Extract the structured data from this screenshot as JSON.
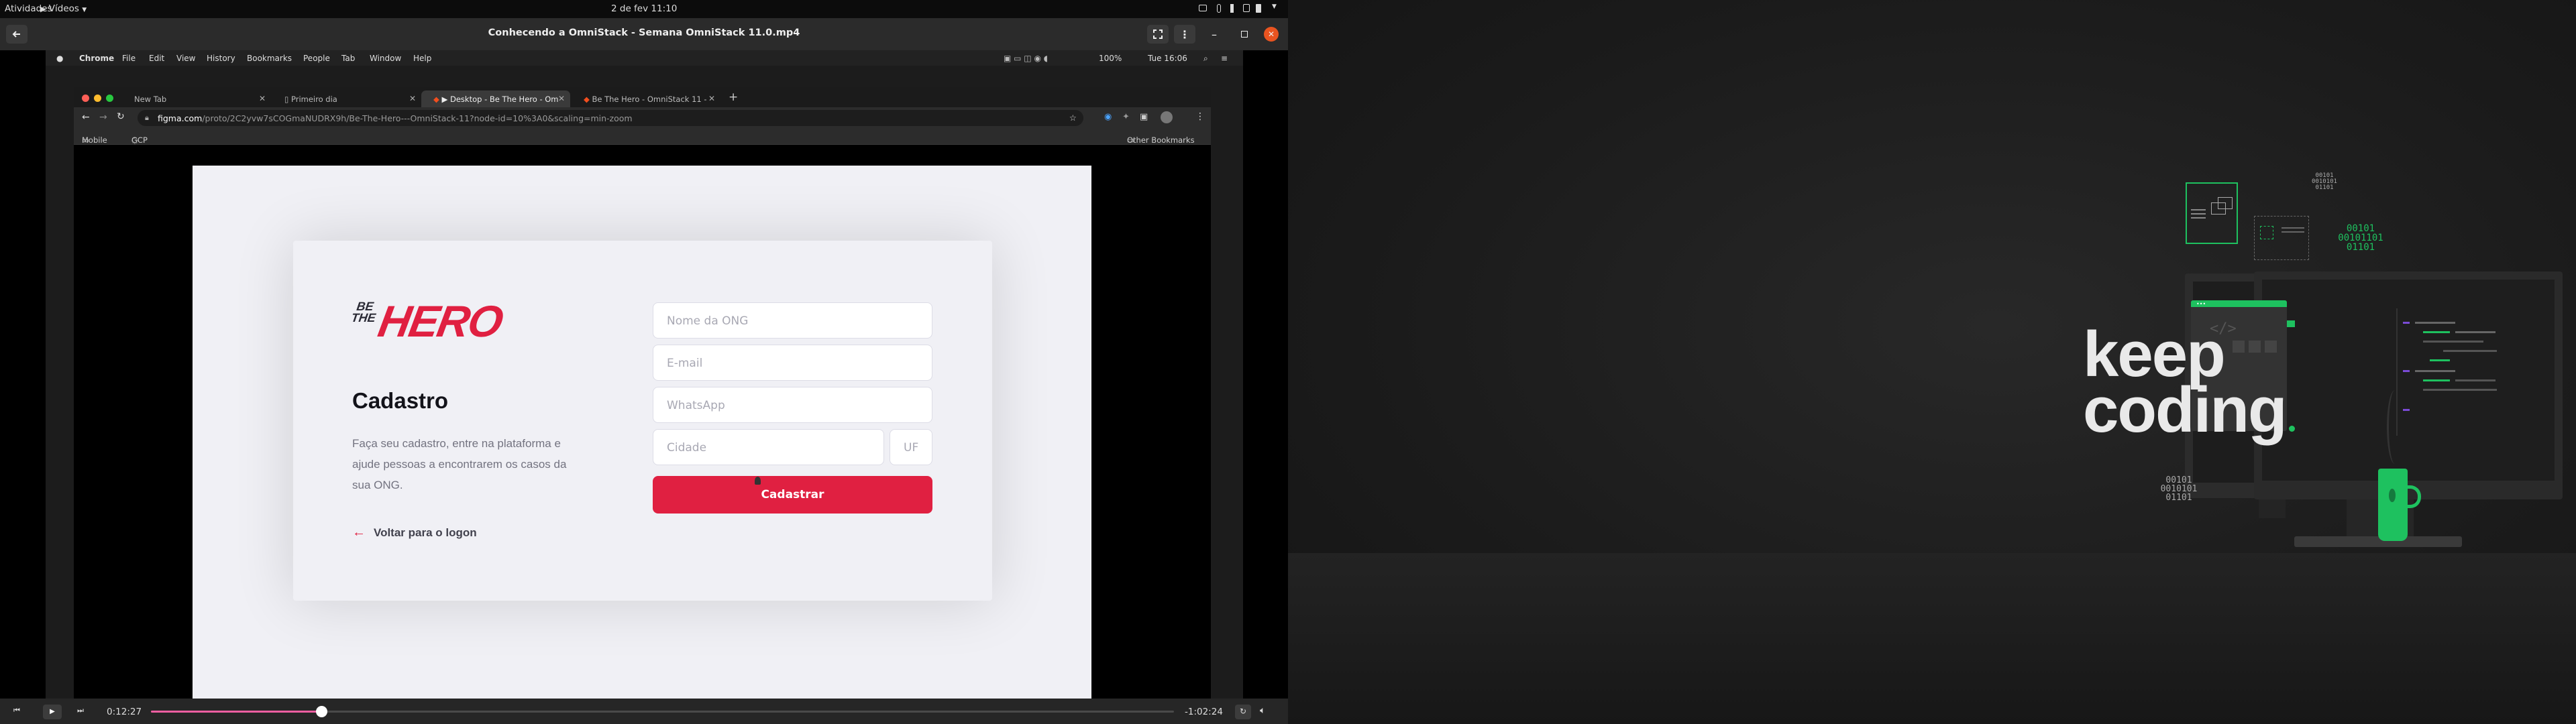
{
  "topbar": {
    "activities": "Atividades",
    "app_menu": "Vídeos",
    "clock": "2 de fev  11:10"
  },
  "player": {
    "title": "Conhecendo a OmniStack - Semana OmniStack 11.0.mp4",
    "elapsed": "0:12:27",
    "remaining": "-1:02:24",
    "progress_fraction": 0.1663
  },
  "macbar": {
    "app": "Chrome",
    "menus": [
      "File",
      "Edit",
      "View",
      "History",
      "Bookmarks",
      "People",
      "Tab",
      "Window",
      "Help"
    ],
    "battery": "100%",
    "clock": "Tue 16:06"
  },
  "chrome": {
    "tabs": [
      {
        "label": "New Tab"
      },
      {
        "label": "Primeiro dia"
      },
      {
        "label": "▶ Desktop - Be The Hero - Om"
      },
      {
        "label": "Be The Hero - OmniStack 11 -"
      }
    ],
    "url_host": "figma.com",
    "url_path": "/proto/2C2yvw7sCOGmaNUDRX9h/Be-The-Hero---OmniStack-11?node-id=10%3A0&scaling=min-zoom",
    "bookmarks": [
      "Mobile",
      "GCP"
    ],
    "other_bookmarks": "Other Bookmarks"
  },
  "signup": {
    "logo_line1": "BE",
    "logo_line2": "THE",
    "logo_word": "HERO",
    "title": "Cadastro",
    "description": "Faça seu cadastro, entre na plataforma e ajude pessoas a encontrarem os casos da sua ONG.",
    "back_link": "Voltar para o logon",
    "fields": {
      "ong_name": "Nome da ONG",
      "email": "E-mail",
      "whatsapp": "WhatsApp",
      "city": "Cidade",
      "uf": "UF"
    },
    "submit": "Cadastrar",
    "accent": "#e02041"
  },
  "wallpaper": {
    "headline_line1": "keep",
    "headline_line2": "coding",
    "binary_top": [
      "00101",
      "0010101",
      "01101"
    ],
    "binary_green": [
      "00101",
      "00101101",
      "01101"
    ],
    "binary_bottom": [
      "00101",
      "0010101",
      "01101"
    ],
    "accent": "#1ec15f"
  }
}
